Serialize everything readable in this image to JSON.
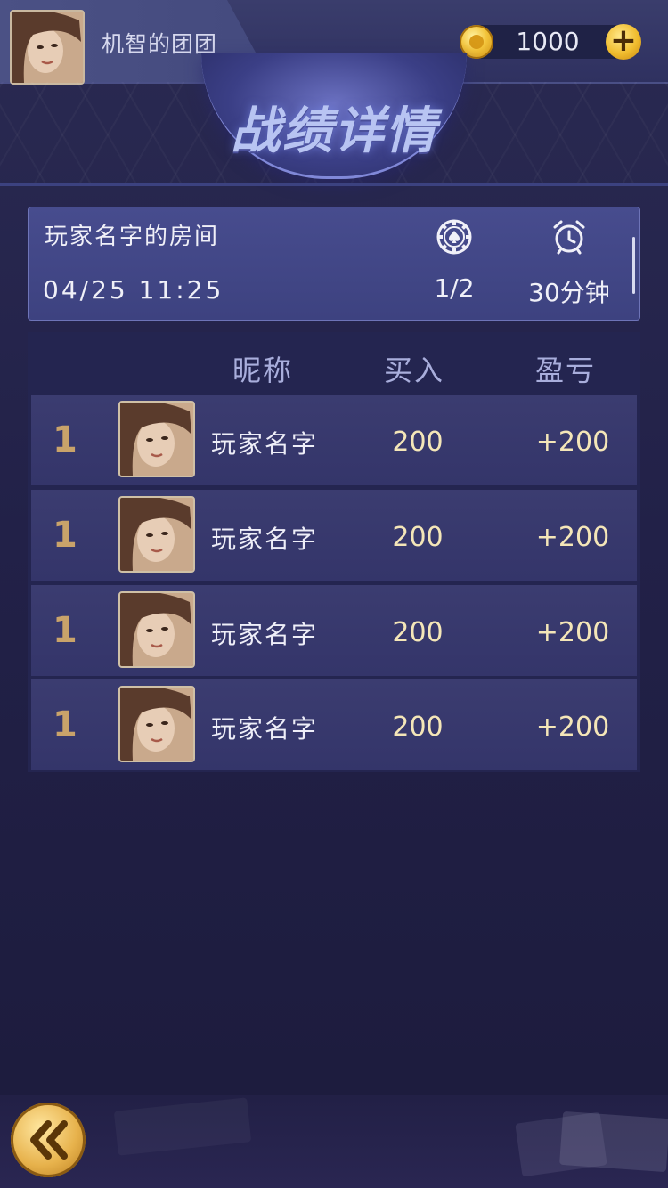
{
  "header": {
    "username": "机智的团团",
    "coins": "1000",
    "add_coins_icon": "plus-icon",
    "coin_icon": "gold-coin-icon"
  },
  "page": {
    "title": "战绩详情"
  },
  "room": {
    "name": "玩家名字的房间",
    "datetime": "04/25  11:25",
    "rounds": "1/2",
    "duration": "30分钟",
    "rounds_icon": "poker-chip-icon",
    "duration_icon": "alarm-clock-icon"
  },
  "table": {
    "headers": {
      "nickname": "昵称",
      "buyin": "买入",
      "profit": "盈亏"
    },
    "rows": [
      {
        "rank": "1",
        "name": "玩家名字",
        "buyin": "200",
        "profit": "+200"
      },
      {
        "rank": "1",
        "name": "玩家名字",
        "buyin": "200",
        "profit": "+200"
      },
      {
        "rank": "1",
        "name": "玩家名字",
        "buyin": "200",
        "profit": "+200"
      },
      {
        "rank": "1",
        "name": "玩家名字",
        "buyin": "200",
        "profit": "+200"
      }
    ]
  },
  "footer": {
    "back_icon": "double-chevron-left-icon"
  },
  "colors": {
    "background": "#222148",
    "gold_text": "#f4e6b8",
    "rank_text": "#c9a36a",
    "header_text": "#a9aedc"
  }
}
